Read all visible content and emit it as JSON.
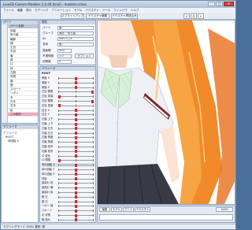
{
  "app": {
    "title": "Live2D Cubism Modeler 2.0.00 [trial] - modeler.cmox"
  },
  "window_controls": {
    "minimize": "–",
    "maximize": "□",
    "close": "×"
  },
  "menu": [
    "ファイル",
    "編集",
    "表示",
    "モデリング",
    "アニメーション",
    "モデル",
    "テクスチャ",
    "ツール",
    "ウィンドウ",
    "ヘルプ"
  ],
  "toolbar": {
    "btn1": "スプライトアップ",
    "btn2": "テクスチャ編集",
    "btn3": "テクスチャ再読込み",
    "icons": [
      "arrow-icon",
      "hand-icon",
      "zoom-icon"
    ]
  },
  "parts_panel": {
    "title": "パーツ",
    "header": "パーツ名称",
    "items": [
      "前髪",
      "後ろ髪",
      "輪郭",
      "顔",
      "左目",
      "右目",
      "眉",
      "鼻",
      "口",
      "体",
      "左腕",
      "右腕",
      "胸",
      "服",
      "スカート",
      "リボン",
      "手",
      "左手",
      "右手",
      "影",
      "この部分"
    ],
    "selected_index": 20
  },
  "deformer_panel": {
    "title": "デフォーマ",
    "items": [
      "デフォーマ",
      "ROOT",
      "体回転 X"
    ]
  },
  "properties": {
    "title": "属性",
    "label_part": "パーツ",
    "part_value": "服",
    "label_group": "グループ",
    "group_value": "胸元・後ろ髪",
    "label_id": "ID",
    "id_value": "PARTS_01",
    "label_name": "名前",
    "name_value": "服",
    "label_order": "描画順",
    "order_value": "500",
    "label_opacity": "不透明度",
    "opacity_value": "1.0",
    "label_extra": "初期値",
    "extra_value": "0",
    "option_btn": "オプション"
  },
  "params_panel": {
    "title": "パラメータ",
    "header": "ROOT",
    "rows": [
      {
        "label": "角度 X",
        "pos": 0.5,
        "group": false
      },
      {
        "label": "角度 Y",
        "pos": 0.5,
        "group": false
      },
      {
        "label": "角度 Z",
        "pos": 0.5,
        "group": false
      },
      {
        "label": "左目 開閉",
        "pos": 1.0,
        "group": false
      },
      {
        "label": "左目 笑顔",
        "pos": 0.0,
        "group": false
      },
      {
        "label": "右目 開閉",
        "pos": 1.0,
        "group": false
      },
      {
        "label": "右目 笑顔",
        "pos": 0.0,
        "group": false
      },
      {
        "label": "目玉 X",
        "pos": 0.5,
        "group": false
      },
      {
        "label": "目玉 Y",
        "pos": 0.5,
        "group": false
      },
      {
        "label": "左眉 上下",
        "pos": 0.5,
        "group": false
      },
      {
        "label": "右眉 上下",
        "pos": 0.5,
        "group": false
      },
      {
        "label": "左眉 左右",
        "pos": 0.5,
        "group": false
      },
      {
        "label": "右眉 左右",
        "pos": 0.5,
        "group": false
      },
      {
        "label": "左眉 角度",
        "pos": 0.5,
        "group": false
      },
      {
        "label": "右眉 角度",
        "pos": 0.5,
        "group": false
      },
      {
        "label": "左眉 変形",
        "pos": 0.5,
        "group": false
      },
      {
        "label": "右眉 変形",
        "pos": 0.5,
        "group": false
      },
      {
        "label": "口 変形",
        "pos": 0.5,
        "group": false
      },
      {
        "label": "口 開閉",
        "pos": 0.0,
        "group": false
      },
      {
        "label": "体の回転 X",
        "pos": 0.5,
        "group": true
      },
      {
        "label": "体の回転 Y",
        "pos": 0.5,
        "group": false
      },
      {
        "label": "体の回転 Z",
        "pos": 0.5,
        "group": false
      },
      {
        "label": "呼吸",
        "pos": 0.5,
        "group": false
      },
      {
        "label": "髪揺れ 前",
        "pos": 0.5,
        "group": false
      },
      {
        "label": "髪揺れ 横",
        "pos": 0.5,
        "group": false
      },
      {
        "label": "髪揺れ 後",
        "pos": 0.5,
        "group": false
      },
      {
        "label": "腕 左",
        "pos": 0.5,
        "group": false
      },
      {
        "label": "腕 右",
        "pos": 0.5,
        "group": false
      },
      {
        "label": "リボン 揺",
        "pos": 0.5,
        "group": false
      },
      {
        "label": "スカート",
        "pos": 0.5,
        "group": false
      },
      {
        "label": "手 状態",
        "pos": 0.5,
        "group": false
      },
      {
        "label": "胸 揺れ",
        "pos": 0.5,
        "group": false
      }
    ]
  },
  "canvas_footer": {
    "btn_edit": "編集",
    "btn_model": "モデル",
    "btn_anim": "アニメ",
    "btn_texture": "テクスチャ",
    "zoom": "100%"
  },
  "status": "モデリングモード 100% 選択: 服"
}
